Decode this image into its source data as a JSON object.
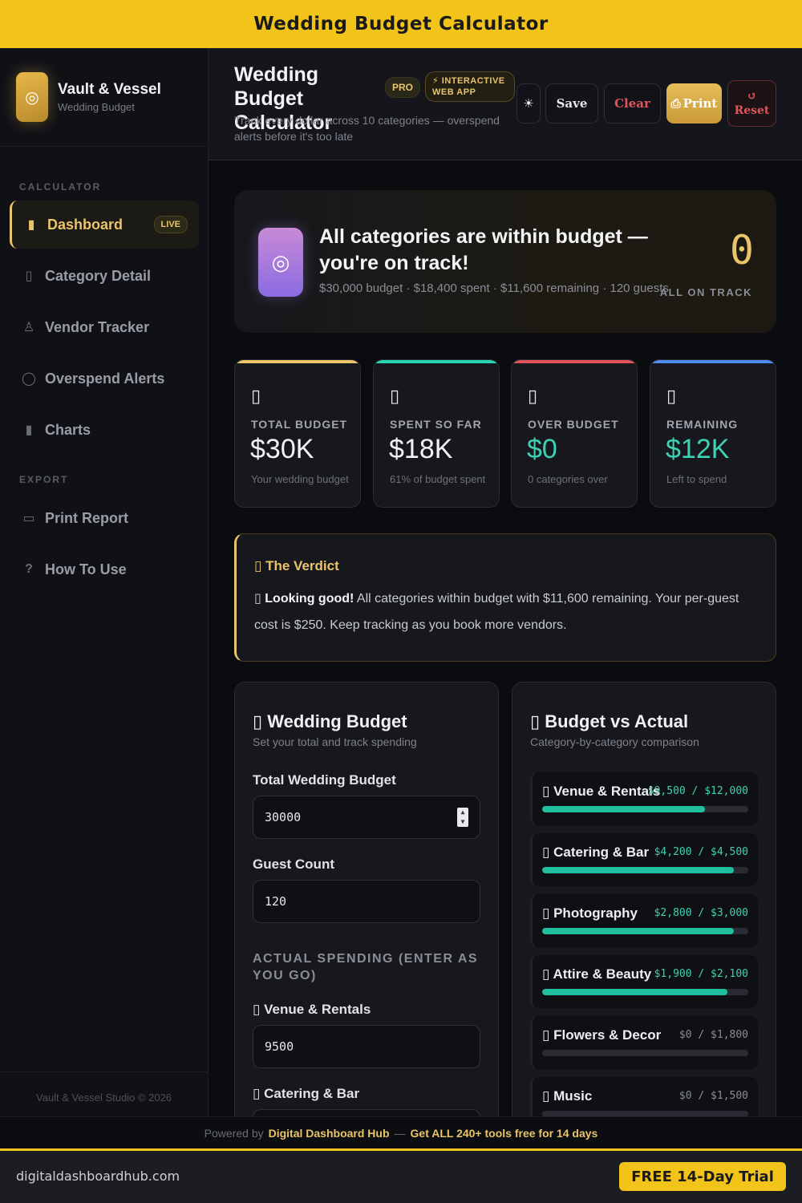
{
  "banner": {
    "title": "Wedding Budget Calculator"
  },
  "brand": {
    "title": "Vault & Vessel",
    "subtitle": "Wedding Budget",
    "logo_icon": "ring-icon"
  },
  "sidebar": {
    "sections": [
      "CALCULATOR",
      "EXPORT"
    ],
    "items": [
      {
        "label": "Dashboard",
        "icon": "bar-chart-icon",
        "active": true,
        "badge": "LIVE"
      },
      {
        "label": "Category Detail",
        "icon": "clipboard-icon"
      },
      {
        "label": "Vendor Tracker",
        "icon": "user-icon"
      },
      {
        "label": "Overspend Alerts",
        "icon": "alert-icon"
      },
      {
        "label": "Charts",
        "icon": "bar-chart-icon"
      },
      {
        "label": "Print Report",
        "icon": "printer-icon"
      },
      {
        "label": "How To Use",
        "icon": "help-icon"
      }
    ],
    "footer": "Vault & Vessel Studio © 2026"
  },
  "header": {
    "title": "Wedding Budget Calculator",
    "pro_badge": "PRO",
    "app_badge": "⚡ INTERACTIVE WEB APP",
    "subtitle": "Track every dollar across 10 categories — overspend alerts before it's too late",
    "buttons": {
      "theme": "☀",
      "save": "Save",
      "clear": "Clear",
      "print": "Print",
      "reset": "Reset"
    }
  },
  "hero": {
    "title": "All categories are within budget — you're on track!",
    "subtitle": "$30,000 budget · $18,400 spent · $11,600 remaining · 120 guests",
    "count": "0",
    "count_label": "ALL ON TRACK",
    "accent": "#e9c46a"
  },
  "stats": [
    {
      "label": "TOTAL BUDGET",
      "value": "$30K",
      "note": "Your wedding budget",
      "color": "#e9c46a"
    },
    {
      "label": "SPENT SO FAR",
      "value": "$18K",
      "note": "61% of budget spent",
      "color": "#2bd4b0"
    },
    {
      "label": "OVER BUDGET",
      "value": "$0",
      "note": "0 categories over",
      "color": "#e0555a"
    },
    {
      "label": "REMAINING",
      "value": "$12K",
      "note": "Left to spend",
      "color": "#4f8ef0"
    }
  ],
  "verdict": {
    "title": "The Verdict",
    "lead": "Looking good!",
    "body": "All categories within budget with $11,600 remaining. Your per-guest cost is $250. Keep tracking as you book more vendors."
  },
  "budget_form": {
    "title": "Wedding Budget",
    "subtitle": "Set your total and track spending",
    "total_label": "Total Wedding Budget",
    "total_value": "30000",
    "guest_label": "Guest Count",
    "guest_value": "120",
    "section": "ACTUAL SPENDING (ENTER AS YOU GO)",
    "fields": [
      {
        "label": "Venue & Rentals",
        "value": "9500"
      },
      {
        "label": "Catering & Bar",
        "value": ""
      }
    ]
  },
  "budget_vs_actual": {
    "title": "Budget vs Actual",
    "subtitle": "Category-by-category comparison",
    "rows": [
      {
        "name": "Venue & Rentals",
        "amount": "$9,500 / $12,000",
        "progress": 0.79
      },
      {
        "name": "Catering & Bar",
        "amount": "$4,200 / $4,500",
        "progress": 0.93
      },
      {
        "name": "Photography",
        "amount": "$2,800 / $3,000",
        "progress": 0.93
      },
      {
        "name": "Attire & Beauty",
        "amount": "$1,900 / $2,100",
        "progress": 0.9
      },
      {
        "name": "Flowers & Decor",
        "amount": "$0 / $1,800",
        "progress": 0
      },
      {
        "name": "Music",
        "amount": "$0 / $1,500",
        "progress": 0
      }
    ]
  },
  "powered": {
    "prefix": "Powered by",
    "hub": "Digital Dashboard Hub",
    "sep": "—",
    "cta": "Get ALL 240+ tools free for 14 days"
  },
  "footer": {
    "url": "digitaldashboardhub.com",
    "trial": "FREE 14-Day Trial"
  }
}
